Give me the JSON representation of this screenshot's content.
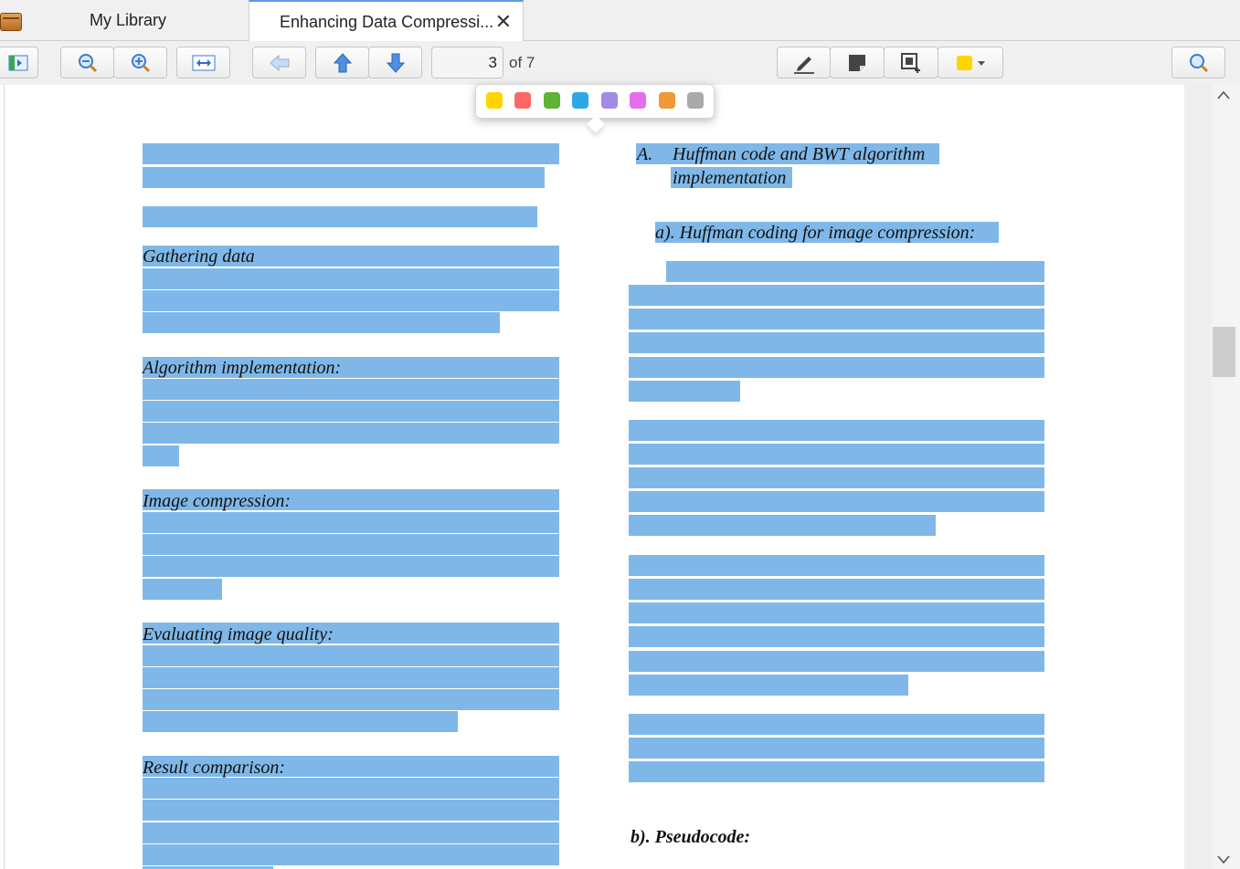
{
  "tabs": {
    "library_label": "My Library",
    "document_label": "Enhancing Data Compressi...",
    "close_glyph": "✕"
  },
  "toolbar": {
    "page_current": "3",
    "page_of": "of 7",
    "buttons": [
      "sidebar-toggle-icon",
      "zoom-out-icon",
      "zoom-in-icon",
      "fit-width-icon",
      "back-arrow-icon",
      "previous-page-icon",
      "next-page-icon",
      "highlight-pen-icon",
      "note-icon",
      "area-select-icon",
      "color-picker-icon",
      "search-icon"
    ],
    "current_color": "#ffd400"
  },
  "color_popup": {
    "colors": [
      "#ffd400",
      "#ff6666",
      "#5fb236",
      "#2ea8e5",
      "#a28ae5",
      "#e56eee",
      "#f19837",
      "#aaaaaa"
    ]
  },
  "document": {
    "left_headings": [
      "Gathering data",
      "Algorithm   implementation:",
      "Image  compression:",
      "Evaluating image quality:",
      "Result  comparison:"
    ],
    "right_heading_a_label": "A.",
    "right_heading_a_line1": "Huffman code and BWT algorithm",
    "right_heading_a_line2": "implementation",
    "right_subheading_a": "a).  Huffman coding for image compression:",
    "right_subheading_b": "b). Pseudocode:",
    "highlight_color": "#7fb8e8"
  },
  "scrollbar": {
    "up_glyph": "^",
    "down_glyph": "v"
  }
}
